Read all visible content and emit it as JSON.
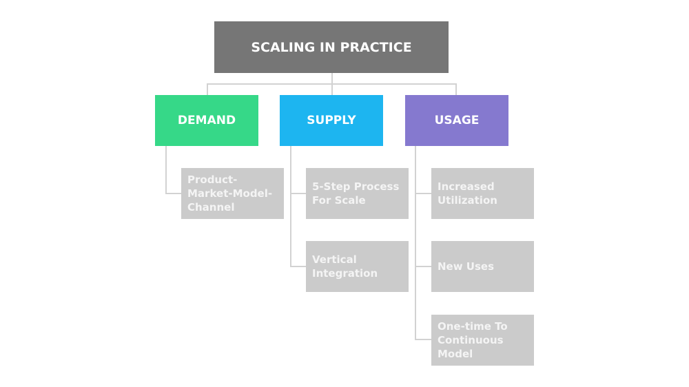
{
  "root": {
    "label": "SCALING IN PRACTICE",
    "color": "#767676"
  },
  "categories": [
    {
      "label": "DEMAND",
      "color": "#36d888",
      "children": [
        "Product-Market-Model-Channel"
      ]
    },
    {
      "label": "SUPPLY",
      "color": "#1db5f0",
      "children": [
        "5-Step Process For Scale",
        "Vertical Integration"
      ]
    },
    {
      "label": "USAGE",
      "color": "#8579cf",
      "children": [
        "Increased Utilization",
        "New Uses",
        "One-time To Continuous Model"
      ]
    }
  ],
  "leaf_color": "#cbcbcb",
  "connector_color": "#d2d2d2"
}
